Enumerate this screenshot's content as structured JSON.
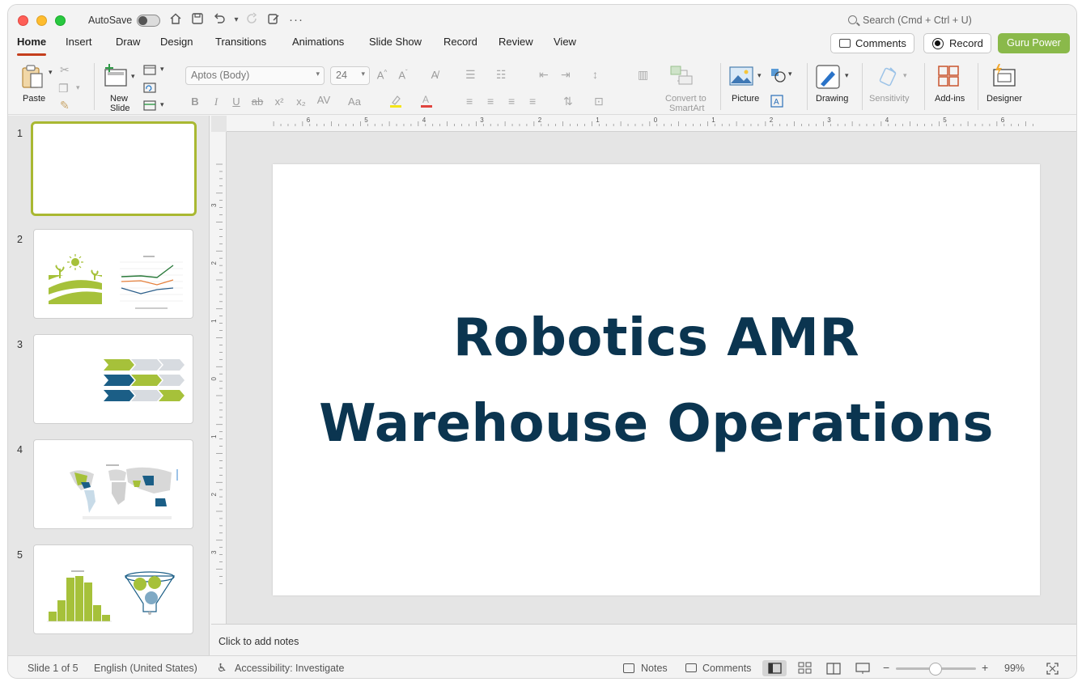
{
  "titlebar": {
    "autosave_label": "AutoSave",
    "search_placeholder": "Search (Cmd + Ctrl + U)"
  },
  "tabs": [
    {
      "label": "Home"
    },
    {
      "label": "Insert"
    },
    {
      "label": "Draw"
    },
    {
      "label": "Design"
    },
    {
      "label": "Transitions"
    },
    {
      "label": "Animations"
    },
    {
      "label": "Slide Show"
    },
    {
      "label": "Record"
    },
    {
      "label": "Review"
    },
    {
      "label": "View"
    }
  ],
  "header_buttons": {
    "comments": "Comments",
    "record": "Record",
    "guru": "Guru Power"
  },
  "ribbon": {
    "paste": "Paste",
    "new_slide_line1": "New",
    "new_slide_line2": "Slide",
    "font_name": "Aptos (Body)",
    "font_size": "24",
    "convert_line1": "Convert to",
    "convert_line2": "SmartArt",
    "picture": "Picture",
    "drawing": "Drawing",
    "sensitivity": "Sensitivity",
    "addins": "Add-ins",
    "designer": "Designer"
  },
  "thumbnails": [
    {
      "num": "1"
    },
    {
      "num": "2"
    },
    {
      "num": "3"
    },
    {
      "num": "4"
    },
    {
      "num": "5"
    }
  ],
  "slide": {
    "title_line1": "Robotics AMR",
    "title_line2": "Warehouse Operations"
  },
  "notes_placeholder": "Click to add notes",
  "status": {
    "slide_info": "Slide 1 of 5",
    "language": "English (United States)",
    "accessibility": "Accessibility: Investigate",
    "notes": "Notes",
    "comments": "Comments",
    "zoom_minus": "−",
    "zoom_plus": "+",
    "zoom": "99%"
  },
  "ruler": {
    "h_labels": [
      "6",
      "5",
      "4",
      "3",
      "2",
      "1",
      "0",
      "1",
      "2",
      "3",
      "4",
      "5",
      "6"
    ],
    "v_labels": [
      "3",
      "2",
      "1",
      "0",
      "1",
      "2",
      "3"
    ]
  },
  "colors": {
    "accent_red": "#c43e1c",
    "guru_green": "#8ab94a",
    "title_navy": "#0b3550",
    "lime": "#a6c13a",
    "teal": "#1b5e86"
  }
}
